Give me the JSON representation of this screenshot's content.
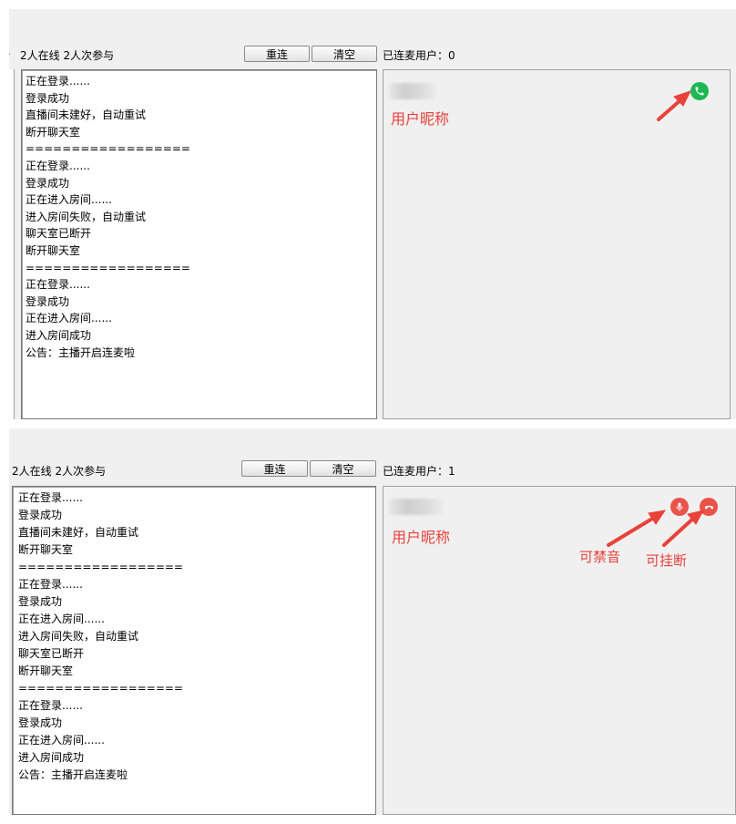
{
  "top": {
    "status_text": "2人在线 2人次参与",
    "buttons": {
      "reconnect": "重连",
      "clear": "清空"
    },
    "connected_users": "已连麦用户：0",
    "log": [
      "正在登录......",
      "登录成功",
      "直播间未建好，自动重试",
      "断开聊天室",
      "==================",
      "正在登录......",
      "登录成功",
      "正在进入房间......",
      "进入房间失败，自动重试",
      "聊天室已断开",
      "断开聊天室",
      "==================",
      "正在登录......",
      "登录成功",
      "正在进入房间......",
      "进入房间成功",
      "公告：主播开启连麦啦"
    ],
    "user": {
      "nickname": "用户昵称",
      "call_icon": "phone-icon",
      "call_color": "#1db954"
    }
  },
  "bottom": {
    "status_text": "2人在线 2人次参与",
    "buttons": {
      "reconnect": "重连",
      "clear": "清空"
    },
    "connected_users": "已连麦用户：1",
    "log": [
      "正在登录......",
      "登录成功",
      "直播间未建好，自动重试",
      "断开聊天室",
      "==================",
      "正在登录......",
      "登录成功",
      "正在进入房间......",
      "进入房间失败，自动重试",
      "聊天室已断开",
      "断开聊天室",
      "==================",
      "正在登录......",
      "登录成功",
      "正在进入房间......",
      "进入房间成功",
      "公告：主播开启连麦啦"
    ],
    "user": {
      "nickname": "用户昵称",
      "mute_icon": "microphone-icon",
      "hangup_icon": "hang-up-icon",
      "icon_color": "#e9534a"
    },
    "annotations": {
      "mute": "可禁音",
      "hangup": "可挂断"
    }
  },
  "annotation_color": "#e8423b"
}
